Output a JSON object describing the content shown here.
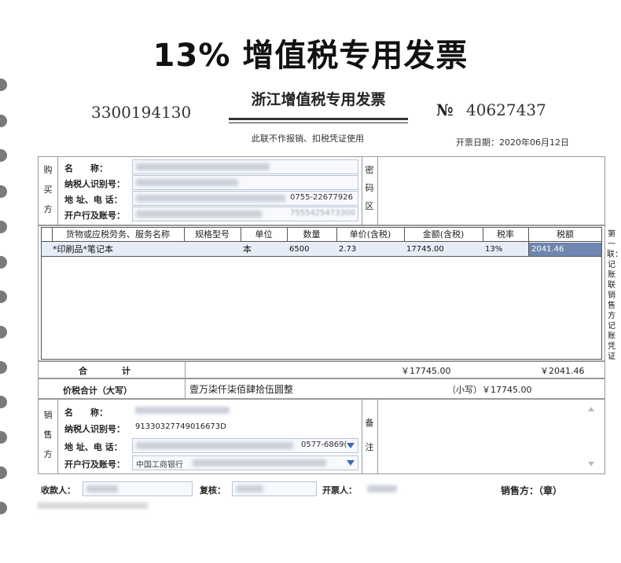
{
  "headline": "13% 增值税专用发票",
  "invoice": {
    "code": "3300194130",
    "title": "浙江增值税专用发票",
    "number_mark": "№",
    "number": "40627437",
    "note": "此联不作报销、扣税凭证使用",
    "date_label": "开票日期：",
    "date_value": "2020年06月12日"
  },
  "buyer": {
    "section_label": [
      "购",
      "买",
      "方"
    ],
    "name_label": "名　　称：",
    "taxid_label": "纳税人识别号：",
    "address_label": "地 址、电 话：",
    "bank_label": "开户行及账号：",
    "address_phone_visible": "0755-22677926",
    "bank_account_visible": "7555425473300"
  },
  "password_area": {
    "label": [
      "密",
      "码",
      "区"
    ]
  },
  "items_table": {
    "headers": [
      "货物或应税劳务、服务名称",
      "规格型号",
      "单位",
      "数量",
      "单价(含税)",
      "金额(含税)",
      "税率",
      "税额"
    ],
    "rows": [
      {
        "name": "*印刷品*笔记本",
        "spec": "",
        "unit": "本",
        "qty": "6500",
        "price": "2.73",
        "amount": "17745.00",
        "rate": "13%",
        "tax": "2041.46"
      }
    ]
  },
  "totals": {
    "label": "合　　　　计",
    "amount": "￥17745.00",
    "tax": "￥2041.46",
    "grand_label": "价税合计（大写）",
    "grand_words": "壹万柒仟柒佰肆拾伍圆整",
    "small_label": "（小写）",
    "small_value": "￥17745.00"
  },
  "seller": {
    "section_label": [
      "销",
      "售",
      "方"
    ],
    "name_label": "名　　称：",
    "taxid_label": "纳税人识别号：",
    "taxid_value": "91330327749016673D",
    "address_label": "地 址、电 话：",
    "address_visible": "0577-6869(",
    "bank_label": "开户行及账号：",
    "bank_visible": "中国工商银行"
  },
  "remarks": {
    "label": [
      "备",
      "注"
    ]
  },
  "footer": {
    "payee_label": "收款人：",
    "reviewer_label": "复核：",
    "drawer_label": "开票人：",
    "seller_seal_label": "销售方：（章）"
  },
  "side_note": "第一联：记账联 销售方记账凭证",
  "colors": {
    "selected_cell": "#6f87b0",
    "row_highlight": "#e6edf6",
    "field_border": "#b7c4d6"
  }
}
